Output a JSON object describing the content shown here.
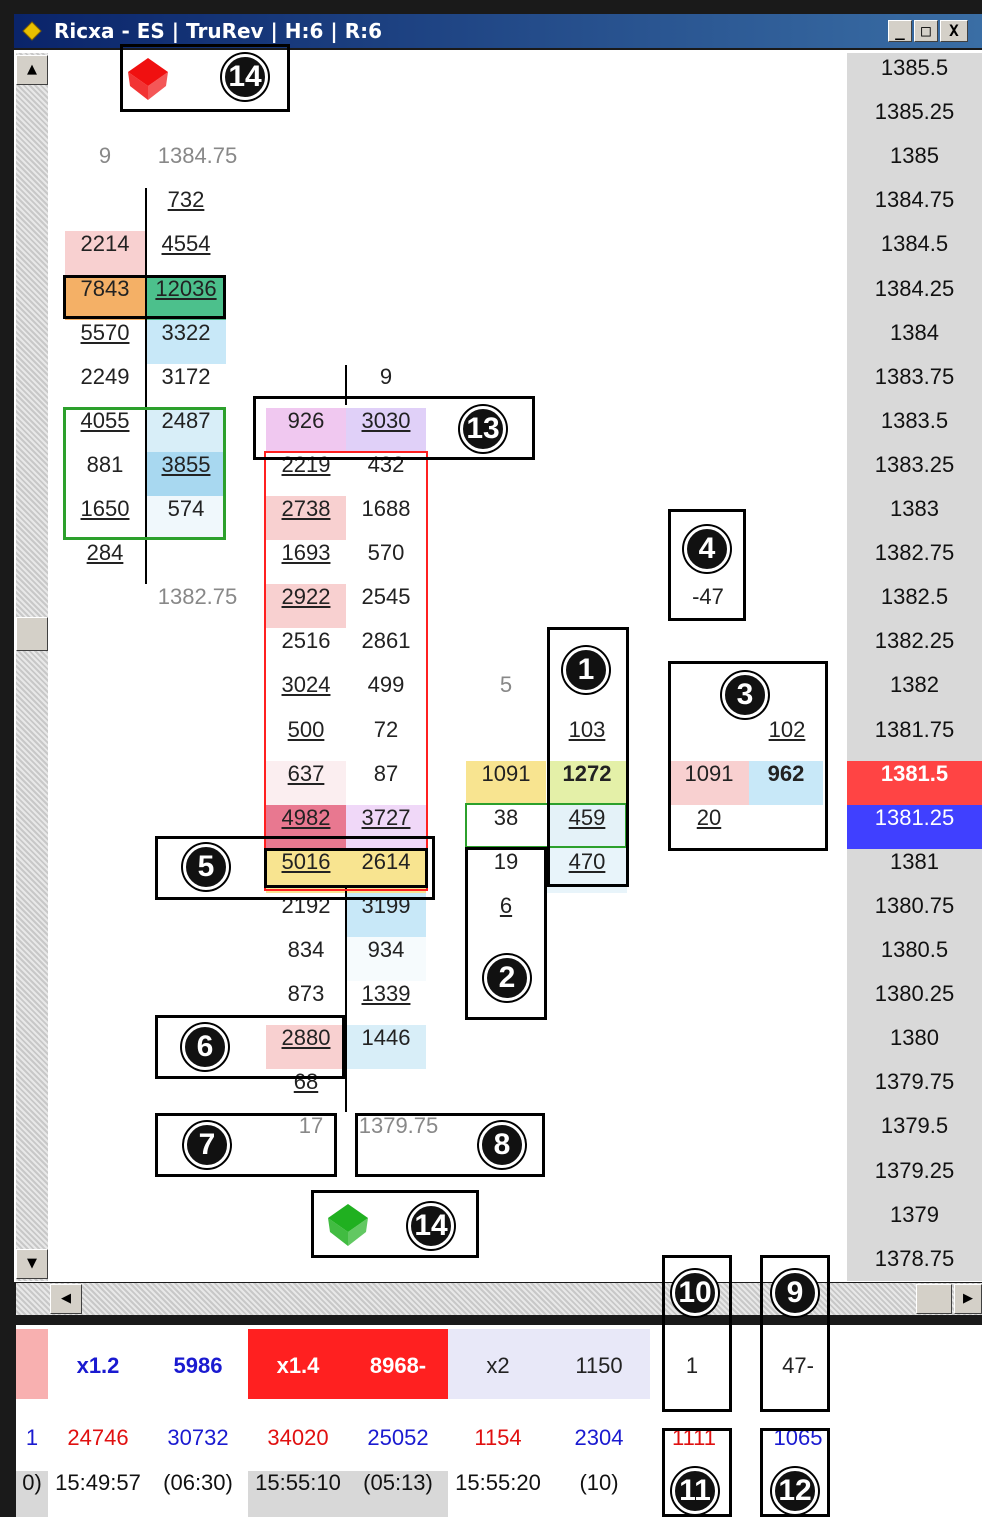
{
  "window": {
    "title": "Ricxa - ES | TruRev | H:6 | R:6",
    "buttons": {
      "minimize": "_",
      "maximize": "□",
      "close": "X"
    }
  },
  "colors": {
    "price_bid_highlight": "#ff4444",
    "price_ask_highlight": "#4040ff",
    "bar_bull": "#2ca02c",
    "bar_bear": "#ff2020",
    "cell_pink": "#f8d0d0",
    "cell_blue": "#c8e8f8",
    "cell_orange": "#f4b066",
    "cell_green": "#4cc08c",
    "cell_yellow": "#f8e490",
    "cell_lavender": "#e0c8f0"
  },
  "price_ladder": [
    "1385.5",
    "1385.25",
    "1385",
    "1384.75",
    "1384.5",
    "1384.25",
    "1384",
    "1383.75",
    "1383.5",
    "1383.25",
    "1383",
    "1382.75",
    "1382.5",
    "1382.25",
    "1382",
    "1381.75",
    "1381.5",
    "1381.25",
    "1381",
    "1380.75",
    "1380.5",
    "1380.25",
    "1380",
    "1379.75",
    "1379.5",
    "1379.25",
    "1379",
    "1378.75"
  ],
  "bar1": {
    "top_count": "9",
    "top_price": "1384.75",
    "bottom_price": "1382.75",
    "ask_top": "732",
    "rows": [
      {
        "bid": "2214",
        "ask": "4554"
      },
      {
        "bid": "7843",
        "ask": "12036"
      },
      {
        "bid": "5570",
        "ask": "3322"
      },
      {
        "bid": "2249",
        "ask": "3172"
      },
      {
        "bid": "4055",
        "ask": "2487"
      },
      {
        "bid": "881",
        "ask": "3855"
      },
      {
        "bid": "1650",
        "ask": "574"
      }
    ],
    "bid_bottom": "284"
  },
  "bar2": {
    "top_count": "9",
    "rows": [
      {
        "bid": "926",
        "ask": "3030"
      },
      {
        "bid": "2219",
        "ask": "432"
      },
      {
        "bid": "2738",
        "ask": "1688"
      },
      {
        "bid": "1693",
        "ask": "570"
      },
      {
        "bid": "2922",
        "ask": "2545"
      },
      {
        "bid": "2516",
        "ask": "2861"
      },
      {
        "bid": "3024",
        "ask": "499"
      },
      {
        "bid": "500",
        "ask": "72"
      },
      {
        "bid": "637",
        "ask": "87"
      },
      {
        "bid": "4982",
        "ask": "3727"
      },
      {
        "bid": "5016",
        "ask": "2614"
      },
      {
        "bid": "2192",
        "ask": "3199"
      },
      {
        "bid": "834",
        "ask": "934"
      },
      {
        "bid": "873",
        "ask": "1339"
      },
      {
        "bid": "2880",
        "ask": "1446"
      }
    ],
    "bid_bottom": "68",
    "bottom_count": "17",
    "bottom_price": "1379.75"
  },
  "bar3": {
    "top_count": "5",
    "ask_top": "103",
    "rows": [
      {
        "bid": "1091",
        "ask": "1272"
      },
      {
        "bid": "38",
        "ask": "459"
      },
      {
        "bid": "19",
        "ask": "470"
      }
    ],
    "bid_bottom": "6"
  },
  "current_bar": {
    "ask_top": "102",
    "bid": "1091",
    "ask": "962",
    "bid_bottom": "20",
    "delta": "-47"
  },
  "badges": [
    "1",
    "2",
    "3",
    "4",
    "5",
    "6",
    "7",
    "8",
    "9",
    "10",
    "11",
    "12",
    "13",
    "14",
    "14"
  ],
  "stats": {
    "row1": [
      "x1.2",
      "5986",
      "x1.4",
      "8968-",
      "x2",
      "1150",
      "1",
      "47-"
    ],
    "row2": [
      "1",
      "24746",
      "30732",
      "34020",
      "25052",
      "1154",
      "2304",
      "1111",
      "1065"
    ],
    "row3": [
      "0)",
      "15:49:57",
      "(06:30)",
      "15:55:10",
      "(05:13)",
      "15:55:20",
      "(10)"
    ]
  }
}
